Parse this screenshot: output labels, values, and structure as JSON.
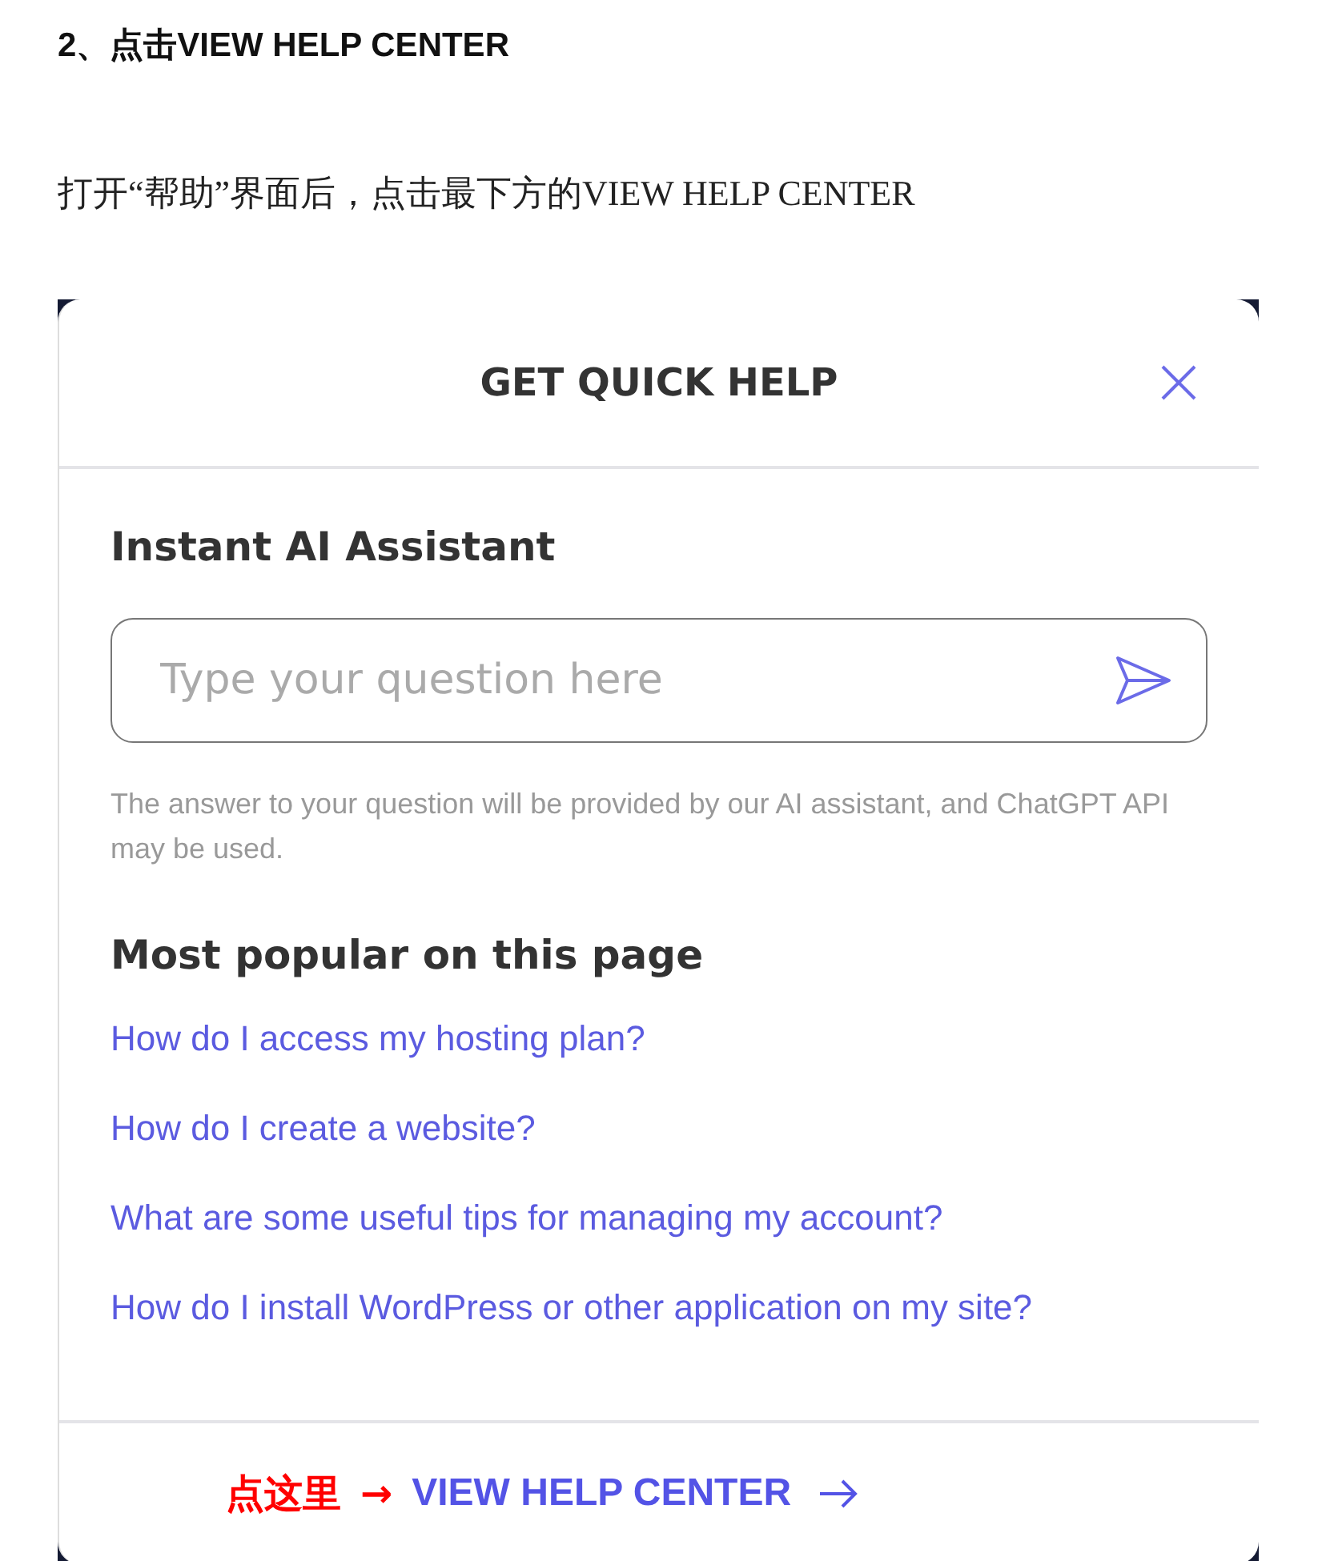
{
  "heading": "2、点击VIEW HELP CENTER",
  "paragraph": "打开“帮助”界面后，点击最下方的VIEW HELP CENTER",
  "panel": {
    "title": "GET QUICK HELP",
    "assistant": {
      "heading": "Instant AI Assistant",
      "placeholder": "Type your question here",
      "note": "The answer to your question will be provided by our AI assistant, and ChatGPT API may be used."
    },
    "popular": {
      "heading": "Most popular on this page",
      "links": [
        "How do I access my hosting plan?",
        "How do I create a website?",
        "What are some useful tips for managing my account?",
        "How do I install WordPress or other application on my site?"
      ]
    },
    "footer": {
      "annotation": "点这里",
      "annotation_arrow": "→",
      "link": "VIEW HELP CENTER"
    }
  }
}
